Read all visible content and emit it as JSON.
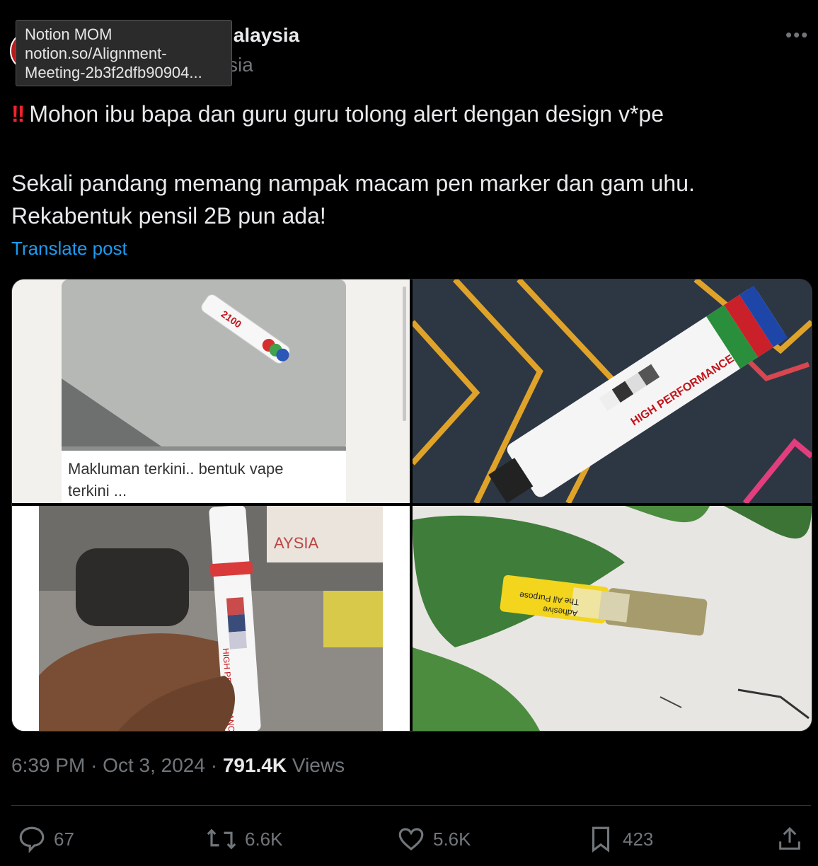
{
  "tooltip": {
    "line1": "Notion MOM",
    "line2": "notion.so/Alignment-",
    "line3": "Meeting-2b3f2dfb90904..."
  },
  "account": {
    "name_visible": "lalaysia",
    "handle_visible": "sia"
  },
  "post": {
    "line1": "Mohon ibu bapa dan guru guru tolong alert dengan design v*pe",
    "line2": "Sekali pandang memang nampak macam pen marker dan gam uhu.",
    "line3": "Rekabentuk pensil 2B pun ada!",
    "translate": "Translate post"
  },
  "media": {
    "tile1_caption_line1": "Makluman terkini.. bentuk vape",
    "tile1_caption_line2": "terkini ...",
    "marker_brand_text": "HIGH PERFORMANCE",
    "marker_number_text": "2100",
    "glue_text_line1": "The All Purpose",
    "glue_text_line2": "Adhesive",
    "hand_marker_text": "HIGH PERFORMANCE",
    "sign_text": "AYSIA"
  },
  "meta": {
    "time": "6:39 PM",
    "sep": "·",
    "date": "Oct 3, 2024",
    "views_count": "791.4K",
    "views_label": "Views"
  },
  "actions": {
    "replies": "67",
    "reposts": "6.6K",
    "likes": "5.6K",
    "bookmarks": "423"
  },
  "colors": {
    "background": "#000000",
    "text": "#e7e9ea",
    "muted": "#71767b",
    "link": "#1d9bf0",
    "alert_red": "#f4212e"
  }
}
